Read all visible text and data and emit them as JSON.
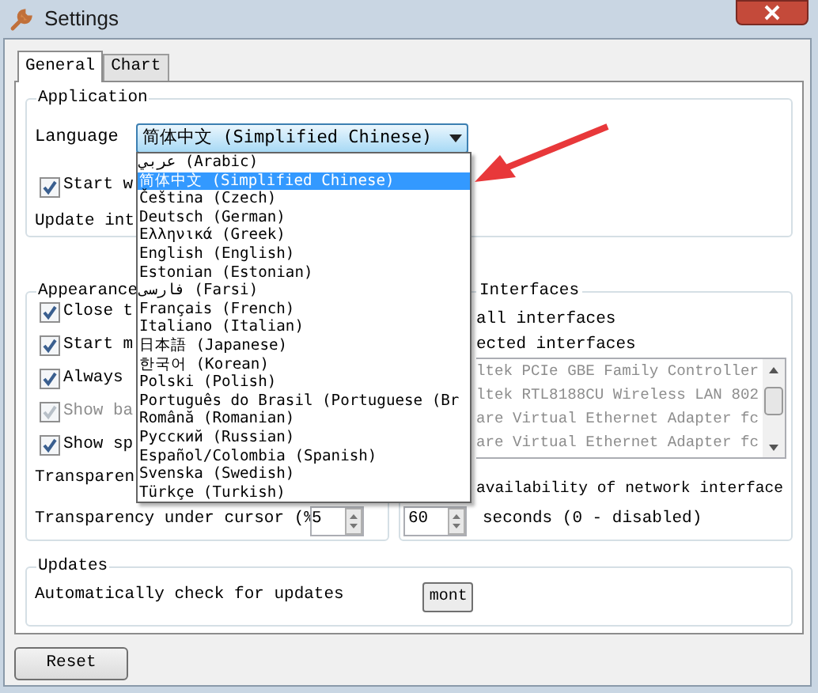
{
  "window": {
    "title": "Settings"
  },
  "tabs": [
    {
      "label": "General",
      "selected": true
    },
    {
      "label": "Chart",
      "selected": false
    }
  ],
  "application": {
    "title": "Application",
    "language_label": "Language",
    "language_value": "简体中文 (Simplified Chinese)",
    "start_checkbox": {
      "label": "Start w",
      "checked": true
    },
    "update_label": "Update int"
  },
  "language_list": [
    {
      "label": "عربي (Arabic)",
      "selected": false
    },
    {
      "label": "简体中文 (Simplified Chinese)",
      "selected": true
    },
    {
      "label": "Čeština (Czech)",
      "selected": false
    },
    {
      "label": "Deutsch (German)",
      "selected": false
    },
    {
      "label": "Ελληνικά (Greek)",
      "selected": false
    },
    {
      "label": "English (English)",
      "selected": false
    },
    {
      "label": "Estonian (Estonian)",
      "selected": false
    },
    {
      "label": "فارسی (Farsi)",
      "selected": false
    },
    {
      "label": "Français (French)",
      "selected": false
    },
    {
      "label": "Italiano (Italian)",
      "selected": false
    },
    {
      "label": "日本語 (Japanese)",
      "selected": false
    },
    {
      "label": "한국어 (Korean)",
      "selected": false
    },
    {
      "label": "Polski (Polish)",
      "selected": false
    },
    {
      "label": "Português do Brasil (Portuguese (Br",
      "selected": false
    },
    {
      "label": "Română (Romanian)",
      "selected": false
    },
    {
      "label": "Русский (Russian)",
      "selected": false
    },
    {
      "label": "Español/Colombia (Spanish)",
      "selected": false
    },
    {
      "label": "Svenska (Swedish)",
      "selected": false
    },
    {
      "label": "Türkçe (Turkish)",
      "selected": false
    }
  ],
  "appearance": {
    "title": "Appearance",
    "checkboxes": [
      {
        "label": "Close t",
        "checked": true,
        "disabled": false
      },
      {
        "label": "Start m",
        "checked": true,
        "disabled": false
      },
      {
        "label": "Always",
        "checked": true,
        "disabled": false
      },
      {
        "label": "Show ba",
        "checked": true,
        "disabled": true
      },
      {
        "label": "Show sp",
        "checked": true,
        "disabled": false
      }
    ],
    "transparency_label": "Transparen",
    "cursor_label": "Transparency under cursor (%",
    "cursor_value": "5"
  },
  "interfaces": {
    "title": "Interfaces",
    "options": [
      "all interfaces",
      "ected interfaces"
    ],
    "list": [
      "ltek PCIe GBE Family Controller",
      "ltek RTL8188CU Wireless LAN 802",
      "are Virtual Ethernet Adapter fc",
      "are Virtual Ethernet Adapter fc"
    ],
    "availability_label": "availability of network interface",
    "interval_value": "60",
    "interval_unit": "seconds (0 - disabled)"
  },
  "updates": {
    "title": "Updates",
    "label": "Automatically check for updates",
    "button": "mont"
  },
  "buttons": [
    "Reset"
  ]
}
